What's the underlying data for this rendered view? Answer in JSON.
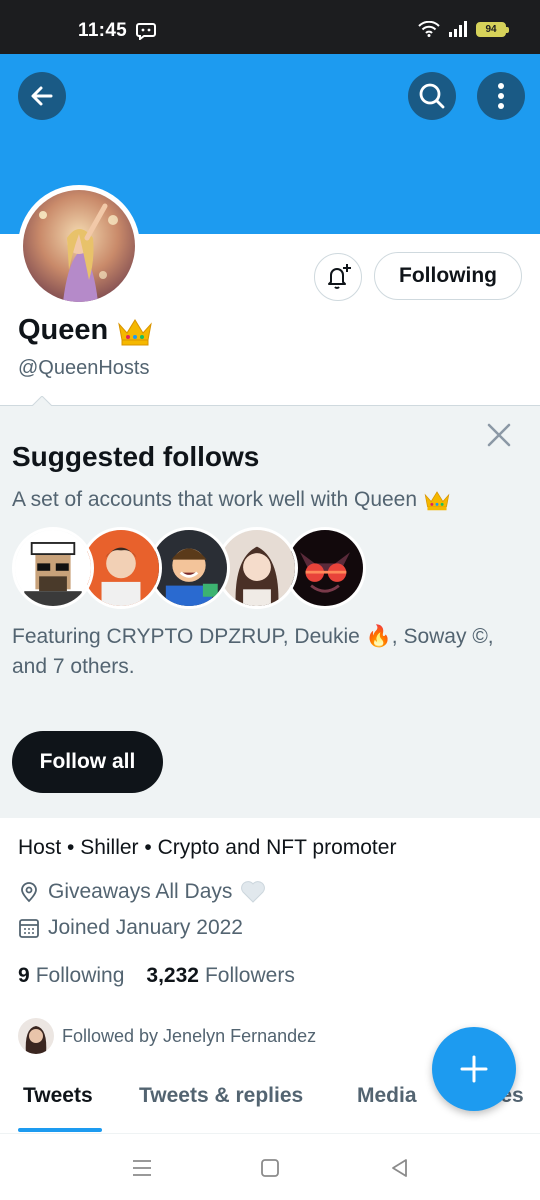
{
  "status_bar": {
    "time": "11:45",
    "battery": "94"
  },
  "header": {
    "back_icon": "arrow-left-icon",
    "search_icon": "search-icon",
    "more_icon": "more-vertical-icon",
    "banner_color": "#1d9bf0"
  },
  "profile": {
    "display_name": "Queen",
    "name_emoji": "crown-emoji",
    "handle": "@QueenHosts",
    "follow_state_label": "Following",
    "bio": "Host • Shiller • Crypto and NFT promoter",
    "location": "Giveaways All Days",
    "joined": "Joined January 2022",
    "following_count": "9",
    "following_label": "Following",
    "followers_count": "3,232",
    "followers_label": "Followers",
    "followed_by": "Followed by Jenelyn Fernandez"
  },
  "suggested": {
    "title": "Suggested follows",
    "description": "A set of accounts that work well with Queen",
    "featuring": "Featuring CRYPTO DPZRUP, Deukie 🔥, Soway ©, and 7 others.",
    "follow_all_label": "Follow all"
  },
  "tabs": [
    {
      "label": "Tweets",
      "active": true
    },
    {
      "label": "Tweets & replies",
      "active": false
    },
    {
      "label": "Media",
      "active": false
    },
    {
      "label": "Likes",
      "active": false
    }
  ],
  "colors": {
    "accent": "#1d9bf0",
    "text": "#0f1419",
    "secondary": "#536471"
  }
}
